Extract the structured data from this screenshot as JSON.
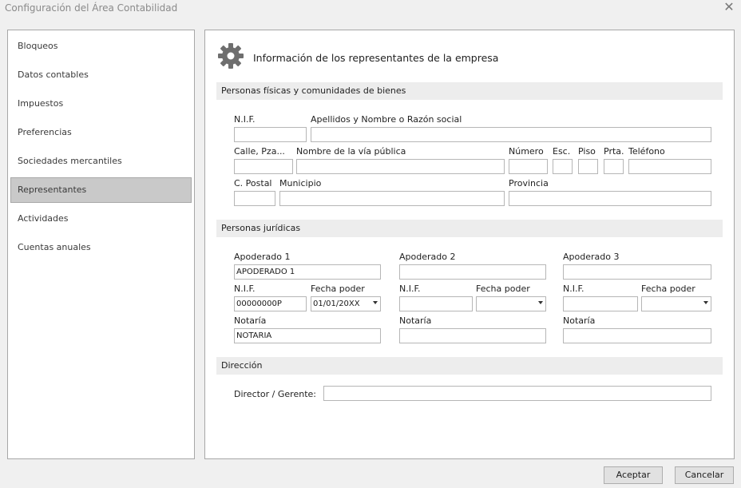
{
  "window": {
    "title": "Configuración del Área Contabilidad",
    "close_glyph": "✕"
  },
  "sidebar": {
    "items": [
      {
        "label": "Bloqueos",
        "active": false
      },
      {
        "label": "Datos contables",
        "active": false
      },
      {
        "label": "Impuestos",
        "active": false
      },
      {
        "label": "Preferencias",
        "active": false
      },
      {
        "label": "Sociedades mercantiles",
        "active": false
      },
      {
        "label": "Representantes",
        "active": true
      },
      {
        "label": "Actividades",
        "active": false
      },
      {
        "label": "Cuentas anuales",
        "active": false
      }
    ]
  },
  "main": {
    "header_icon": "gear-icon",
    "header_title": "Información de los representantes de la empresa",
    "fisicas": {
      "section_title": "Personas físicas y comunidades de bienes",
      "nif_label": "N.I.F.",
      "apellidos_label": "Apellidos y Nombre o Razón social",
      "calle_label": "Calle, Pza...",
      "via_label": "Nombre de la vía pública",
      "numero_label": "Número",
      "esc_label": "Esc.",
      "piso_label": "Piso",
      "prta_label": "Prta.",
      "telefono_label": "Teléfono",
      "cpostal_label": "C. Postal",
      "municipio_label": "Municipio",
      "provincia_label": "Provincia",
      "values": {
        "nif": "",
        "apellidos": "",
        "calle": "",
        "via": "",
        "numero": "",
        "esc": "",
        "piso": "",
        "prta": "",
        "telefono": "",
        "cpostal": "",
        "municipio": "",
        "provincia": ""
      }
    },
    "juridicas": {
      "section_title": "Personas jurídicas",
      "apoderados": [
        {
          "label": "Apoderado 1",
          "value": "APODERADO 1",
          "nif_label": "N.I.F.",
          "nif": "00000000P",
          "fecha_label": "Fecha poder",
          "fecha": "01/01/20XX",
          "notaria_label": "Notaría",
          "notaria": "NOTARIA"
        },
        {
          "label": "Apoderado 2",
          "value": "",
          "nif_label": "N.I.F.",
          "nif": "",
          "fecha_label": "Fecha poder",
          "fecha": "",
          "notaria_label": "Notaría",
          "notaria": ""
        },
        {
          "label": "Apoderado 3",
          "value": "",
          "nif_label": "N.I.F.",
          "nif": "",
          "fecha_label": "Fecha poder",
          "fecha": "",
          "notaria_label": "Notaría",
          "notaria": ""
        }
      ]
    },
    "direccion": {
      "section_title": "Dirección",
      "director_label": "Director / Gerente:",
      "director_value": ""
    }
  },
  "footer": {
    "accept_label": "Aceptar",
    "cancel_label": "Cancelar"
  }
}
